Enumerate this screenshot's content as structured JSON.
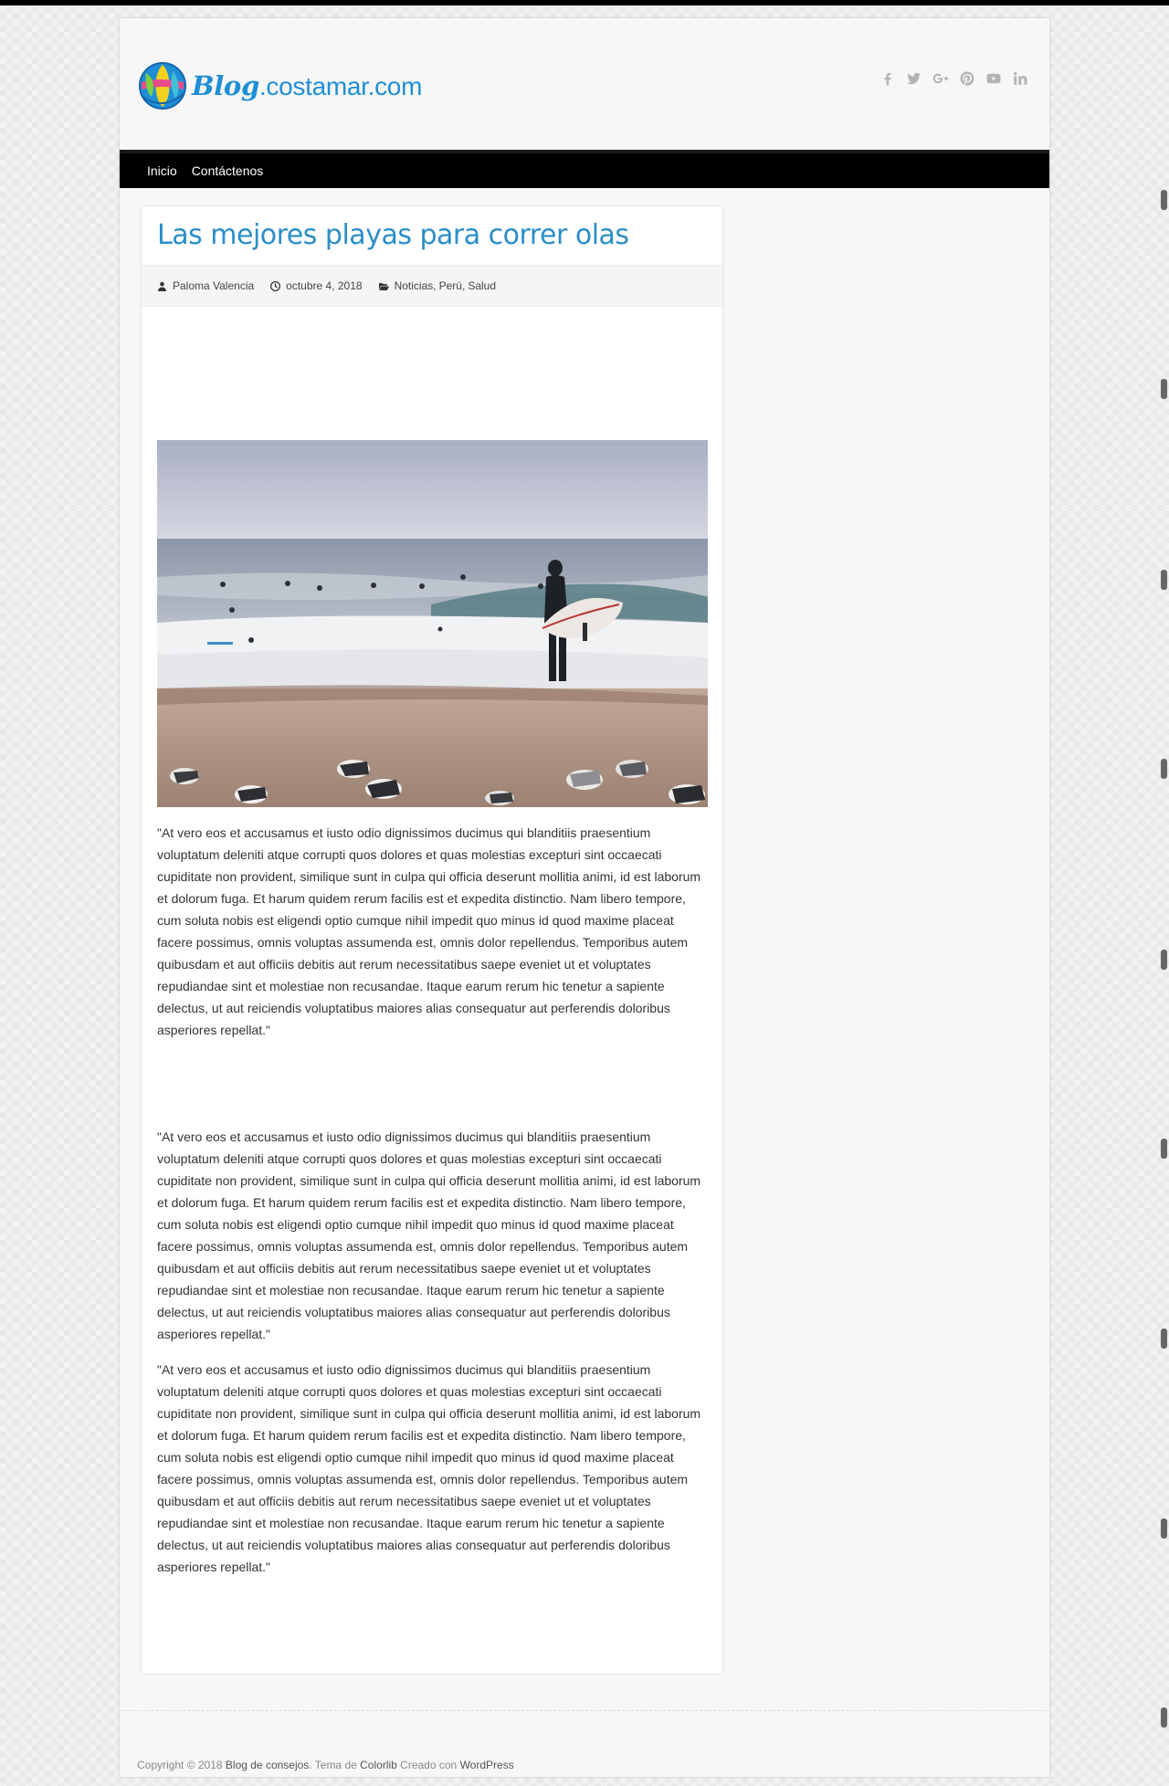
{
  "site": {
    "logo_part1": "Blog",
    "logo_part2": ".costamar.com"
  },
  "social": {
    "icons": [
      "facebook-icon",
      "twitter-icon",
      "google-plus-icon",
      "pinterest-icon",
      "youtube-icon",
      "linkedin-icon"
    ]
  },
  "nav": {
    "items": [
      {
        "label": "Inicio"
      },
      {
        "label": "Contáctenos"
      }
    ]
  },
  "article": {
    "title": "Las mejores playas para correr olas",
    "author": "Paloma Valencia",
    "date": "octubre 4, 2018",
    "categories": [
      "Noticias",
      "Perú",
      "Salud"
    ],
    "paragraphs": [
      "\"At vero eos et accusamus et iusto odio dignissimos ducimus qui blanditiis praesentium voluptatum deleniti atque corrupti quos dolores et quas molestias excepturi sint occaecati cupiditate non provident, similique sunt in culpa qui officia deserunt mollitia animi, id est laborum et dolorum fuga. Et harum quidem rerum facilis est et expedita distinctio. Nam libero tempore, cum soluta nobis est eligendi optio cumque nihil impedit quo minus id quod maxime placeat facere possimus, omnis voluptas assumenda est, omnis dolor repellendus. Temporibus autem quibusdam et aut officiis debitis aut rerum necessitatibus saepe eveniet ut et voluptates repudiandae sint et molestiae non recusandae. Itaque earum rerum hic tenetur a sapiente delectus, ut aut reiciendis voluptatibus maiores alias consequatur aut perferendis doloribus asperiores repellat.\"",
      "\"At vero eos et accusamus et iusto odio dignissimos ducimus qui blanditiis praesentium voluptatum deleniti atque corrupti quos dolores et quas molestias excepturi sint occaecati cupiditate non provident, similique sunt in culpa qui officia deserunt mollitia animi, id est laborum et dolorum fuga. Et harum quidem rerum facilis est et expedita distinctio. Nam libero tempore, cum soluta nobis est eligendi optio cumque nihil impedit quo minus id quod maxime placeat facere possimus, omnis voluptas assumenda est, omnis dolor repellendus. Temporibus autem quibusdam et aut officiis debitis aut rerum necessitatibus saepe eveniet ut et voluptates repudiandae sint et molestiae non recusandae. Itaque earum rerum hic tenetur a sapiente delectus, ut aut reiciendis voluptatibus maiores alias consequatur aut perferendis doloribus asperiores repellat.\"",
      "\"At vero eos et accusamus et iusto odio dignissimos ducimus qui blanditiis praesentium voluptatum deleniti atque corrupti quos dolores et quas molestias excepturi sint occaecati cupiditate non provident, similique sunt in culpa qui officia deserunt mollitia animi, id est laborum et dolorum fuga. Et harum quidem rerum facilis est et expedita distinctio. Nam libero tempore, cum soluta nobis est eligendi optio cumque nihil impedit quo minus id quod maxime placeat facere possimus, omnis voluptas assumenda est, omnis dolor repellendus. Temporibus autem quibusdam et aut officiis debitis aut rerum necessitatibus saepe eveniet ut et voluptates repudiandae sint et molestiae non recusandae. Itaque earum rerum hic tenetur a sapiente delectus, ut aut reiciendis voluptatibus maiores alias consequatur aut perferendis doloribus asperiores repellat.\""
    ]
  },
  "footer": {
    "copyright": "Copyright © 2018",
    "site_link": "Blog de consejos",
    "theme_prefix": ". Tema de",
    "theme_link": "Colorlib",
    "created_prefix": "Creado con",
    "wp_link": "WordPress"
  },
  "colors": {
    "accent": "#2a8ec8",
    "logo": "#1e8fd6",
    "nav_bg": "#000000",
    "social_icon": "#b4b4b4"
  }
}
